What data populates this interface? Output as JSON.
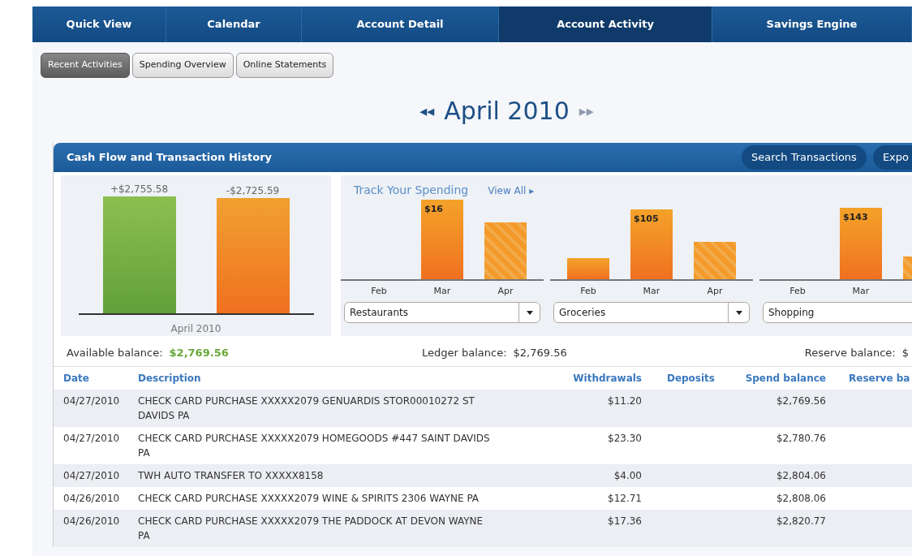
{
  "nav": [
    {
      "label": "Quick View",
      "selected": false
    },
    {
      "label": "Calendar",
      "selected": false
    },
    {
      "label": "Account Detail",
      "selected": false
    },
    {
      "label": "Account Activity",
      "selected": true
    },
    {
      "label": "Savings Engine",
      "selected": false
    }
  ],
  "subtabs": [
    {
      "label": "Recent Activities",
      "selected": true
    },
    {
      "label": "Spending Overview",
      "selected": false
    },
    {
      "label": "Online Statements",
      "selected": false
    }
  ],
  "month": {
    "prev": "◂◂",
    "label": "April 2010",
    "next": "▸▸"
  },
  "panel": {
    "title": "Cash Flow and Transaction History",
    "buttons": [
      "Search Transactions",
      "Expo"
    ]
  },
  "cash_flow": {
    "bars": [
      {
        "kind": "income",
        "label": "+$2,755.58"
      },
      {
        "kind": "spending",
        "label": "-$2,725.59"
      }
    ],
    "period": "April 2010"
  },
  "spending": {
    "title": "Track Your Spending",
    "link": "View All ▸",
    "tiles": [
      {
        "months": [
          "Feb",
          "Mar",
          "Apr"
        ],
        "mar_label": "$16",
        "category": "Restaurants"
      },
      {
        "months": [
          "Feb",
          "Mar",
          "Apr"
        ],
        "mar_label": "$105",
        "category": "Groceries"
      },
      {
        "months": [
          "Feb",
          "Mar"
        ],
        "mar_label": "$143",
        "category": "Shopping"
      }
    ]
  },
  "balances": [
    {
      "label": "Available balance:",
      "value": "$2,769.56"
    },
    {
      "label": "Ledger balance:",
      "value": "$2,769.56"
    },
    {
      "label": "Reserve balance:",
      "value": "$"
    }
  ],
  "table": {
    "columns": [
      "Date",
      "Description",
      "Withdrawals",
      "Deposits",
      "Spend balance",
      "Reserve ba"
    ],
    "rows": [
      [
        "04/27/2010",
        "CHECK CARD PURCHASE XXXXX2079 GENUARDIS STOR00010272 ST DAVIDS PA",
        "$11.20",
        "",
        "$2,769.56"
      ],
      [
        "04/27/2010",
        "CHECK CARD PURCHASE XXXXX2079 HOMEGOODS #447 SAINT DAVIDS PA",
        "$23.30",
        "",
        "$2,780.76"
      ],
      [
        "04/27/2010",
        "TWH AUTO TRANSFER TO XXXXX8158",
        "$4.00",
        "",
        "$2,804.06"
      ],
      [
        "04/26/2010",
        "CHECK CARD PURCHASE XXXXX2079 WINE & SPIRITS 2306 WAYNE PA",
        "$12.71",
        "",
        "$2,808.06"
      ],
      [
        "04/26/2010",
        "CHECK CARD PURCHASE XXXXX2079 THE PADDOCK AT DEVON WAYNE PA",
        "$17.36",
        "",
        "$2,820.77"
      ]
    ]
  }
}
